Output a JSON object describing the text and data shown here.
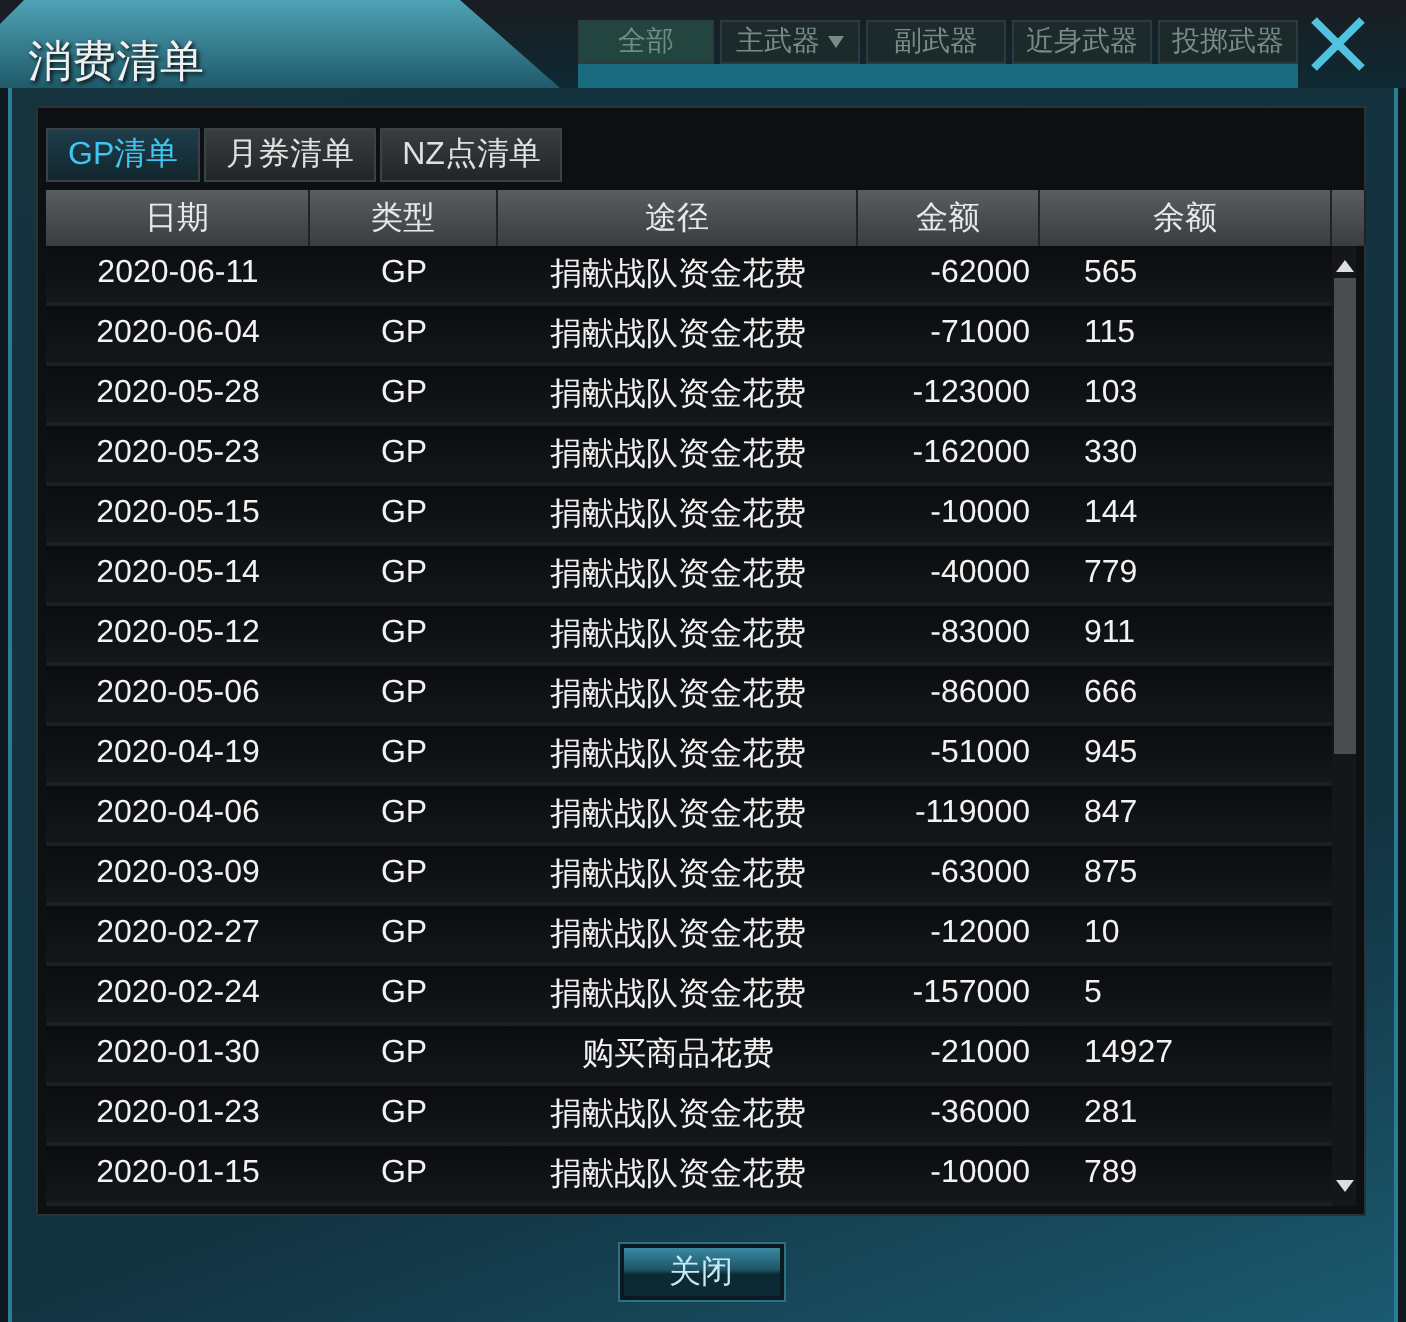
{
  "background_toolbar": [
    {
      "label": "全部",
      "selected": true,
      "dropdown": false
    },
    {
      "label": "主武器",
      "selected": false,
      "dropdown": true
    },
    {
      "label": "副武器",
      "selected": false,
      "dropdown": false
    },
    {
      "label": "近身武器",
      "selected": false,
      "dropdown": false
    },
    {
      "label": "投掷武器",
      "selected": false,
      "dropdown": false
    }
  ],
  "window": {
    "title": "消费清单"
  },
  "tabs": [
    {
      "label": "GP清单",
      "selected": true
    },
    {
      "label": "月券清单",
      "selected": false
    },
    {
      "label": "NZ点清单",
      "selected": false
    }
  ],
  "table": {
    "columns": [
      "日期",
      "类型",
      "途径",
      "金额",
      "余额"
    ],
    "rows": [
      [
        "2020-06-11",
        "GP",
        "捐献战队资金花费",
        "-62000",
        "565"
      ],
      [
        "2020-06-04",
        "GP",
        "捐献战队资金花费",
        "-71000",
        "115"
      ],
      [
        "2020-05-28",
        "GP",
        "捐献战队资金花费",
        "-123000",
        "103"
      ],
      [
        "2020-05-23",
        "GP",
        "捐献战队资金花费",
        "-162000",
        "330"
      ],
      [
        "2020-05-15",
        "GP",
        "捐献战队资金花费",
        "-10000",
        "144"
      ],
      [
        "2020-05-14",
        "GP",
        "捐献战队资金花费",
        "-40000",
        "779"
      ],
      [
        "2020-05-12",
        "GP",
        "捐献战队资金花费",
        "-83000",
        "911"
      ],
      [
        "2020-05-06",
        "GP",
        "捐献战队资金花费",
        "-86000",
        "666"
      ],
      [
        "2020-04-19",
        "GP",
        "捐献战队资金花费",
        "-51000",
        "945"
      ],
      [
        "2020-04-06",
        "GP",
        "捐献战队资金花费",
        "-119000",
        "847"
      ],
      [
        "2020-03-09",
        "GP",
        "捐献战队资金花费",
        "-63000",
        "875"
      ],
      [
        "2020-02-27",
        "GP",
        "捐献战队资金花费",
        "-12000",
        "10"
      ],
      [
        "2020-02-24",
        "GP",
        "捐献战队资金花费",
        "-157000",
        "5"
      ],
      [
        "2020-01-30",
        "GP",
        "购买商品花费",
        "-21000",
        "14927"
      ],
      [
        "2020-01-23",
        "GP",
        "捐献战队资金花费",
        "-36000",
        "281"
      ],
      [
        "2020-01-15",
        "GP",
        "捐献战队资金花费",
        "-10000",
        "789"
      ]
    ]
  },
  "buttons": [
    "关闭"
  ]
}
